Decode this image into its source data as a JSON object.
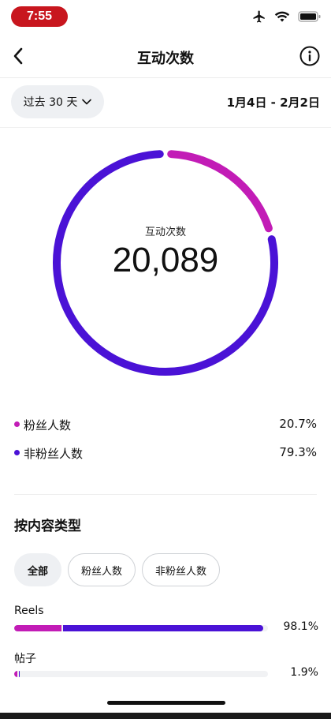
{
  "status": {
    "time": "7:55"
  },
  "nav": {
    "title": "互动次数"
  },
  "filter": {
    "range_label": "过去 30 天",
    "date_range": "1月4日 - 2月2日"
  },
  "donut": {
    "label": "互动次数",
    "value": "20,089",
    "follower_fraction": 0.207
  },
  "legend": [
    {
      "label": "粉丝人数",
      "value": "20.7%",
      "color": "#c21cb6"
    },
    {
      "label": "非粉丝人数",
      "value": "79.3%",
      "color": "#4a12d6"
    }
  ],
  "content_type": {
    "title": "按内容类型",
    "chips": [
      {
        "label": "全部"
      },
      {
        "label": "粉丝人数"
      },
      {
        "label": "非粉丝人数"
      }
    ],
    "items": [
      {
        "label": "Reels",
        "value": "98.1%",
        "fraction": 0.981,
        "follower_share": 0.19
      },
      {
        "label": "帖子",
        "value": "1.9%",
        "fraction": 0.019,
        "follower_share": 0.6
      }
    ]
  },
  "colors": {
    "follower": "#c21cb6",
    "non_follower": "#4a12d6"
  },
  "icons": [
    "back-chevron-icon",
    "info-icon",
    "chevron-down-icon",
    "airplane-icon",
    "wifi-icon",
    "battery-icon"
  ]
}
